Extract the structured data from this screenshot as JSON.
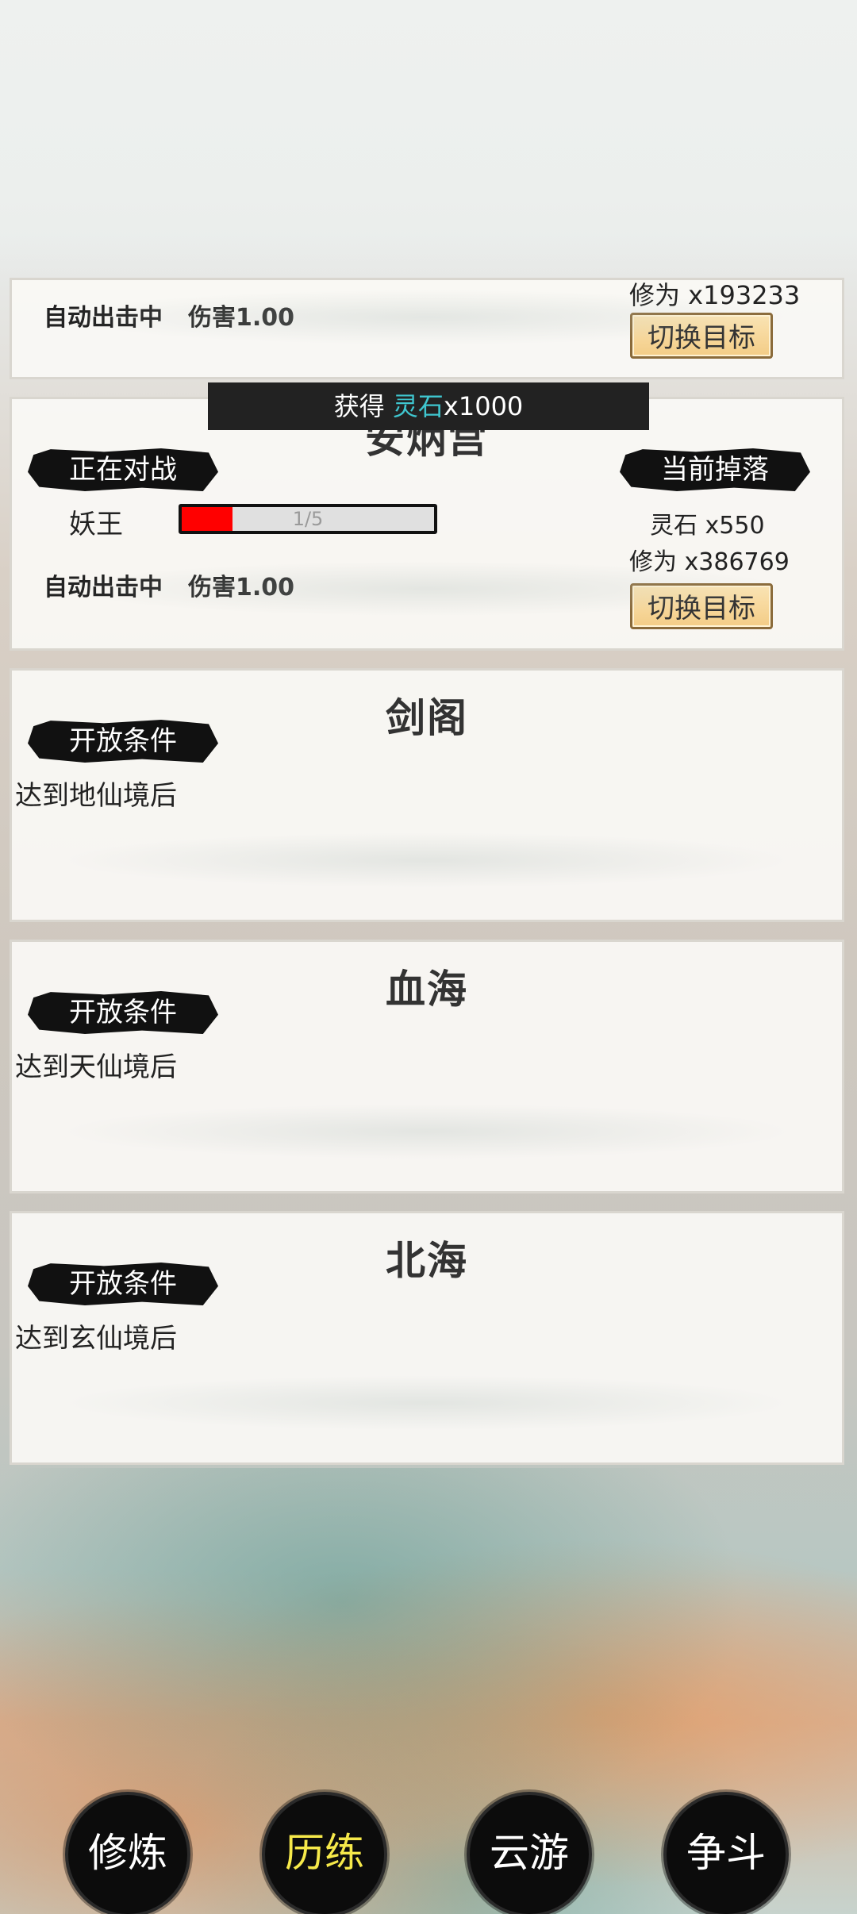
{
  "toast": {
    "prefix": "获得 ",
    "item": "灵石",
    "amount": "x1000"
  },
  "top_panel": {
    "drop_xiuwei": "修为 x193233",
    "auto_status": "自动出击中",
    "damage": "伤害1.00",
    "switch_label": "切换目标"
  },
  "battle_panel": {
    "title": "安炳宫",
    "fighting_label": "正在对战",
    "drop_label": "当前掉落",
    "enemy_name": "妖王",
    "hp_text": "1/5",
    "hp_fraction": 0.2,
    "drop_lingshi": "灵石 x550",
    "drop_xiuwei": "修为 x386769",
    "auto_status": "自动出击中",
    "damage": "伤害1.00",
    "switch_label": "切换目标"
  },
  "locked_panels": [
    {
      "title": "剑阁",
      "cond_label": "开放条件",
      "cond_text": "达到地仙境后"
    },
    {
      "title": "血海",
      "cond_label": "开放条件",
      "cond_text": "达到天仙境后"
    },
    {
      "title": "北海",
      "cond_label": "开放条件",
      "cond_text": "达到玄仙境后"
    }
  ],
  "nav": {
    "items": [
      "修炼",
      "历练",
      "云游",
      "争斗"
    ],
    "active_index": 1
  },
  "colors": {
    "active_nav": "#f6e94a",
    "toast_highlight": "#3fc6cf",
    "hp_fill": "#ff0000"
  }
}
